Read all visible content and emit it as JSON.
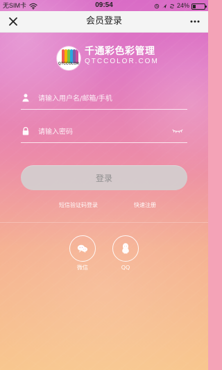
{
  "status_bar": {
    "carrier": "无SIM卡",
    "time": "09:54",
    "battery": "24%",
    "battery_level": 0.24
  },
  "header": {
    "title": "会员登录"
  },
  "brand": {
    "name": "千通彩色彩管理",
    "url": "QTCCOLOR.COM",
    "logo_text": "QTCCOLOR",
    "logo_colors": [
      "#f25c54",
      "#f4b400",
      "#7bc043",
      "#2aa7df",
      "#7b5ea7",
      "#c94d9f"
    ]
  },
  "form": {
    "username_placeholder": "请输入用户名/邮箱/手机",
    "password_placeholder": "请输入密码",
    "login_label": "登录"
  },
  "links": {
    "sms_login": "短信验证码登录",
    "quick_register": "快速注册"
  },
  "social": {
    "wechat_label": "微信",
    "qq_label": "QQ"
  },
  "colors": {
    "button_bg": "#d3d3d3",
    "button_text": "#8f8f8f",
    "header_bg": "#f4f4f4"
  }
}
